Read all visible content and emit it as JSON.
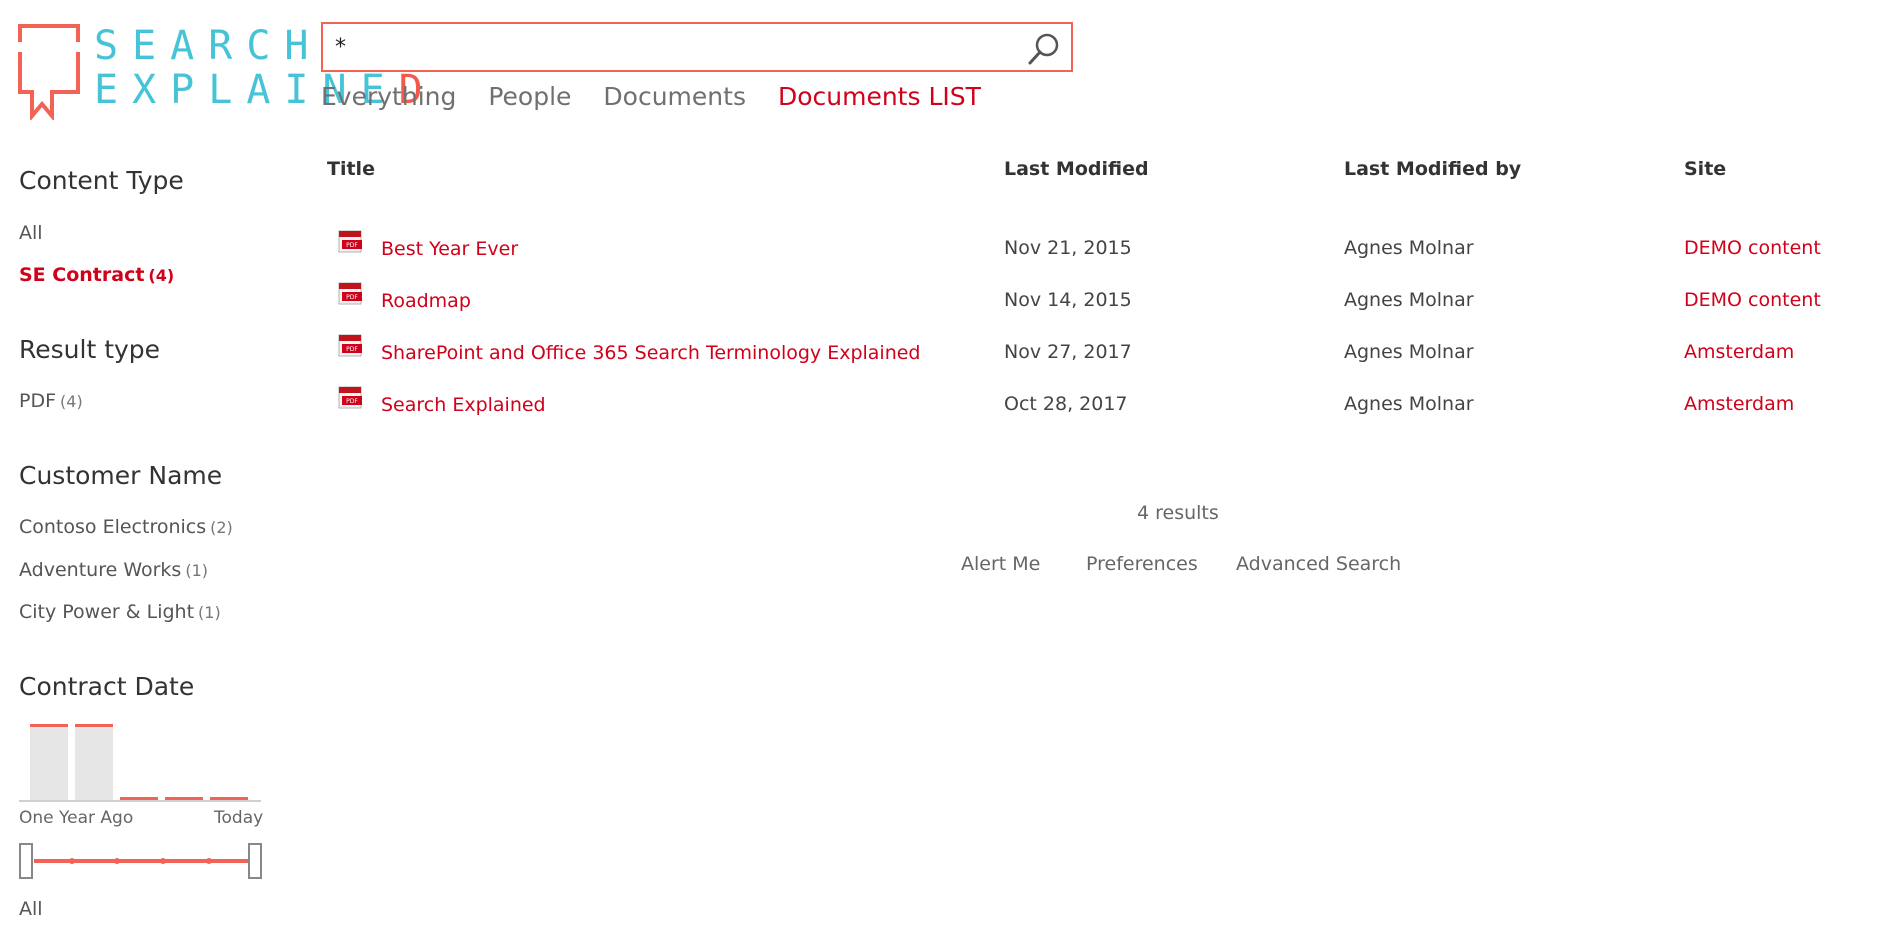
{
  "logo": {
    "line1": "SEARCH",
    "line2_main": "EXPLAINE",
    "line2_accent": "D"
  },
  "search": {
    "value": "*",
    "placeholder": ""
  },
  "tabs": [
    {
      "label": "Everything",
      "active": false
    },
    {
      "label": "People",
      "active": false
    },
    {
      "label": "Documents",
      "active": false
    },
    {
      "label": "Documents LIST",
      "active": true
    }
  ],
  "refiners": {
    "content_type": {
      "title": "Content Type",
      "items": [
        {
          "label": "All",
          "count": ""
        },
        {
          "label": "SE Contract",
          "count": "(4)",
          "selected": true
        }
      ]
    },
    "result_type": {
      "title": "Result type",
      "items": [
        {
          "label": "PDF",
          "count": "(4)"
        }
      ]
    },
    "customer_name": {
      "title": "Customer Name",
      "items": [
        {
          "label": "Contoso Electronics",
          "count": "(2)"
        },
        {
          "label": "Adventure Works",
          "count": "(1)"
        },
        {
          "label": "City Power & Light",
          "count": "(1)"
        }
      ]
    },
    "contract_date": {
      "title": "Contract Date",
      "range_start": "One Year Ago",
      "range_end": "Today",
      "selection": "All",
      "histogram_levels": [
        1.0,
        1.0,
        0.0,
        0.0,
        0.0
      ]
    }
  },
  "results": {
    "columns": {
      "title": "Title",
      "last_modified": "Last Modified",
      "last_modified_by": "Last Modified by",
      "site": "Site"
    },
    "rows": [
      {
        "title": "Best Year Ever",
        "last_modified": "Nov 21, 2015",
        "author": "Agnes Molnar",
        "site": "DEMO content",
        "icon": "pdf-icon"
      },
      {
        "title": "Roadmap",
        "last_modified": "Nov 14, 2015",
        "author": "Agnes Molnar",
        "site": "DEMO content",
        "icon": "pdf-icon"
      },
      {
        "title": "SharePoint and Office 365 Search Terminology Explained",
        "last_modified": "Nov 27, 2017",
        "author": "Agnes Molnar",
        "site": "Amsterdam",
        "icon": "pdf-icon"
      },
      {
        "title": "Search Explained",
        "last_modified": "Oct 28, 2017",
        "author": "Agnes Molnar",
        "site": "Amsterdam",
        "icon": "pdf-icon"
      }
    ],
    "count_text": "4 results"
  },
  "footer_links": {
    "alert_me": "Alert Me",
    "preferences": "Preferences",
    "advanced_search": "Advanced Search"
  },
  "colors": {
    "accent": "#d0021b",
    "brand_red": "#f26355",
    "brand_teal": "#46c3d6"
  }
}
